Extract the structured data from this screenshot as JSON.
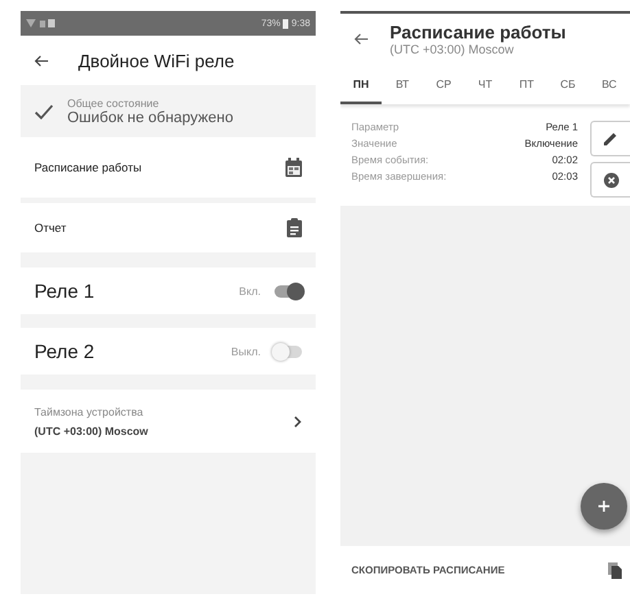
{
  "device_screen": {
    "status_bar": {
      "battery": "73%",
      "time": "9:38"
    },
    "title": "Двойное WiFi реле",
    "state": {
      "label": "Общее состояние",
      "value": "Ошибок не обнаружено"
    },
    "menu": [
      {
        "label": "Расписание работы",
        "kind": "calendar"
      },
      {
        "label": "Отчет",
        "kind": "report"
      }
    ],
    "relays": [
      {
        "name": "Реле 1",
        "status": "Вкл.",
        "on": true
      },
      {
        "name": "Реле 2",
        "status": "Выкл.",
        "on": false
      }
    ],
    "timezone": {
      "label": "Таймзона устройства",
      "value": "(UTC +03:00) Moscow"
    }
  },
  "schedule_screen": {
    "title": "Расписание работы",
    "subtitle": "(UTC +03:00) Moscow",
    "tabs": [
      {
        "label": "ПН",
        "selected": true
      },
      {
        "label": "ВТ",
        "selected": false
      },
      {
        "label": "СР",
        "selected": false
      },
      {
        "label": "ЧТ",
        "selected": false
      },
      {
        "label": "ПТ",
        "selected": false
      },
      {
        "label": "СБ",
        "selected": false
      },
      {
        "label": "ВС",
        "selected": false
      }
    ],
    "event_rows": [
      {
        "label": "Параметр",
        "value": "Реле 1"
      },
      {
        "label": "Значение",
        "value": "Включение"
      },
      {
        "label": "Время события:",
        "value": "02:02"
      },
      {
        "label": "Время завершения:",
        "value": "02:03"
      }
    ],
    "copy_button": "СКОПИРОВАТЬ РАСПИСАНИЕ"
  }
}
